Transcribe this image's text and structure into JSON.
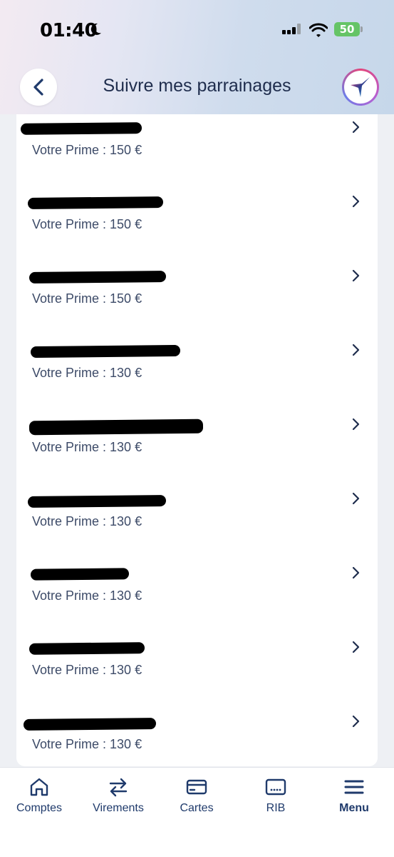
{
  "status_bar": {
    "time": "01:40",
    "battery": "50"
  },
  "header": {
    "title": "Suivre mes parrainages"
  },
  "referrals": [
    {
      "name": "[redacted]",
      "prime": "Votre Prime : 150 €"
    },
    {
      "name": "[redacted]",
      "prime": "Votre Prime : 150 €"
    },
    {
      "name": "[redacted]",
      "prime": "Votre Prime : 150 €"
    },
    {
      "name": "[redacted]",
      "prime": "Votre Prime : 130 €"
    },
    {
      "name": "[redacted]",
      "prime": "Votre Prime : 130 €"
    },
    {
      "name": "[redacted]",
      "prime": "Votre Prime : 130 €"
    },
    {
      "name": "[redacted]",
      "prime": "Votre Prime : 130 €"
    },
    {
      "name": "[redacted]",
      "prime": "Votre Prime : 130 €"
    },
    {
      "name": "[redacted]",
      "prime": "Votre Prime : 130 €"
    }
  ],
  "tab_bar": {
    "tabs": [
      {
        "label": "Comptes",
        "icon": "home-icon"
      },
      {
        "label": "Virements",
        "icon": "transfer-arrows-icon"
      },
      {
        "label": "Cartes",
        "icon": "card-icon"
      },
      {
        "label": "RIB",
        "icon": "rib-icon"
      },
      {
        "label": "Menu",
        "icon": "menu-icon",
        "active": true
      }
    ]
  },
  "colors": {
    "primary": "#1f3a6b",
    "text": "#3d4b68",
    "battery": "#65c466"
  }
}
